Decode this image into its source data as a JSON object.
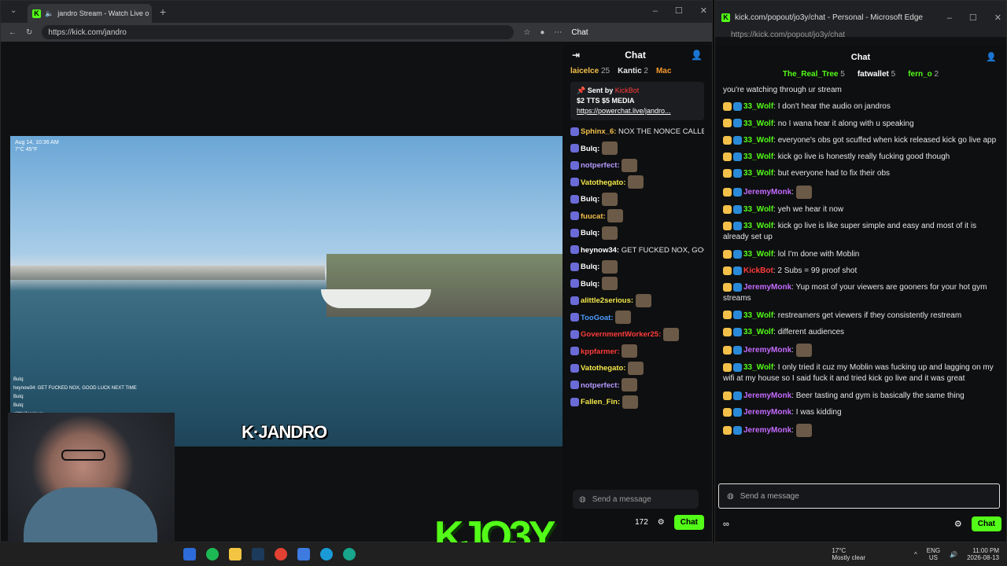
{
  "browser1": {
    "tab_title": "jandro Stream - Watch Live o",
    "url": "https://kick.com/jandro",
    "chat_button": "Chat"
  },
  "video": {
    "clock_line1": "Aug 14, 10:36 AM",
    "clock_line2": "7°C 45°F",
    "logo": "K·JANDRO",
    "minichat": [
      "Bulq:",
      "heynow34: GET FUCKED NOX, GOOD LUCK NEXT TIME",
      "Bulq:",
      "Bulq:",
      "alittle2serious:"
    ]
  },
  "chat1": {
    "title": "Chat",
    "top": [
      {
        "name": "laicelce",
        "count": "25",
        "color": "#f3c04a"
      },
      {
        "name": "Kantic",
        "count": "2",
        "color": "#ffffff"
      },
      {
        "name": "Mac",
        "count": "",
        "color": "#f39a2e"
      }
    ],
    "pin": {
      "sent_by": "Sent by",
      "sender": "KickBot",
      "line1": "$2 TTS $5 MEDIA",
      "link": "https://powerchat.live/jandro..."
    },
    "messages": [
      {
        "user": "Sphinx_6:",
        "text": "NOX THE NONCE CALLED COPS",
        "color": "#f3c04a"
      },
      {
        "user": "Bulq:",
        "text": "",
        "color": "#ffffff"
      },
      {
        "user": "notperfect:",
        "text": "",
        "color": "#b59aff"
      },
      {
        "user": "Vatothegato:",
        "text": "",
        "color": "#f3e84a"
      },
      {
        "user": "Bulq:",
        "text": "",
        "color": "#ffffff"
      },
      {
        "user": "fuucat:",
        "text": "",
        "color": "#f3c04a"
      },
      {
        "user": "Bulq:",
        "text": "",
        "color": "#ffffff"
      },
      {
        "user": "heynow34:",
        "text": "GET FUCKED NOX, GOOD LUCK NEXT TIME",
        "color": "#ffffff"
      },
      {
        "user": "Bulq:",
        "text": "",
        "color": "#ffffff"
      },
      {
        "user": "Bulq:",
        "text": "",
        "color": "#ffffff"
      },
      {
        "user": "alittle2serious:",
        "text": "",
        "color": "#f3e84a"
      },
      {
        "user": "TooGoat:",
        "text": "",
        "color": "#4a9cff"
      },
      {
        "user": "GovernmentWorker25:",
        "text": "",
        "color": "#ff3b3b"
      },
      {
        "user": "kppfarmer:",
        "text": "",
        "color": "#ff3b3b"
      },
      {
        "user": "Vatothegato:",
        "text": "",
        "color": "#f3e84a"
      },
      {
        "user": "notperfect:",
        "text": "",
        "color": "#b59aff"
      },
      {
        "user": "Fallen_Fin:",
        "text": "",
        "color": "#f3e84a"
      }
    ],
    "input_placeholder": "Send a message",
    "viewers": "172",
    "send": "Chat"
  },
  "browser2": {
    "title": "kick.com/popout/jo3y/chat - Personal - Microsoft Edge",
    "url": "https://kick.com/popout/jo3y/chat"
  },
  "chat2": {
    "title": "Chat",
    "top": [
      {
        "name": "The_Real_Tree",
        "count": "5"
      },
      {
        "name": "fatwallet",
        "count": "5"
      },
      {
        "name": "fern_o",
        "count": "2"
      }
    ],
    "messages": [
      {
        "user": "",
        "text": "you're watching through ur stream",
        "color": "#ffffff"
      },
      {
        "user": "33_Wolf",
        "text": "I don't hear the audio on jandros",
        "color": "#53fc18"
      },
      {
        "user": "33_Wolf",
        "text": "no I wana hear it along with u speaking",
        "color": "#53fc18"
      },
      {
        "user": "33_Wolf",
        "text": "everyone's obs got scuffed when kick released kick go live app",
        "color": "#53fc18"
      },
      {
        "user": "33_Wolf",
        "text": "kick go live is honestly really fucking good though",
        "color": "#53fc18"
      },
      {
        "user": "33_Wolf",
        "text": "but everyone had to fix their obs",
        "color": "#53fc18"
      },
      {
        "user": "JeremyMonk",
        "text": "",
        "color": "#c46bff"
      },
      {
        "user": "33_Wolf",
        "text": "yeh we hear it now",
        "color": "#53fc18"
      },
      {
        "user": "33_Wolf",
        "text": "kick go live is like super simple and easy and most of it is already set up",
        "color": "#53fc18"
      },
      {
        "user": "33_Wolf",
        "text": "lol I'm done with Moblin",
        "color": "#53fc18"
      },
      {
        "user": "KickBot",
        "text": "2 Subs = 99 proof shot",
        "color": "#ff3b3b"
      },
      {
        "user": "JeremyMonk",
        "text": "Yup most of your viewers are gooners for your hot gym streams",
        "color": "#c46bff"
      },
      {
        "user": "33_Wolf",
        "text": "restreamers get viewers if they consistently restream",
        "color": "#53fc18"
      },
      {
        "user": "33_Wolf",
        "text": "different audiences",
        "color": "#53fc18"
      },
      {
        "user": "JeremyMonk",
        "text": "",
        "color": "#c46bff"
      },
      {
        "user": "33_Wolf",
        "text": "I only tried it cuz my Moblin was fucking up and lagging on my wifi at my house so I said fuck it and tried kick go live and it was great",
        "color": "#53fc18"
      },
      {
        "user": "JeremyMonk",
        "text": "Beer tasting and gym is basically the same thing",
        "color": "#c46bff"
      },
      {
        "user": "JeremyMonk",
        "text": "I was kidding",
        "color": "#c46bff"
      },
      {
        "user": "JeremyMonk",
        "text": "",
        "color": "#c46bff"
      }
    ],
    "input_placeholder": "Send a message",
    "send": "Chat"
  },
  "taskbar": {
    "weather_temp": "17°C",
    "weather_desc": "Mostly clear",
    "lang": "ENG",
    "region": "US",
    "time": "11:00 PM",
    "date": "2026-08-13"
  },
  "overlay": {
    "brand": "KJO3Y"
  }
}
